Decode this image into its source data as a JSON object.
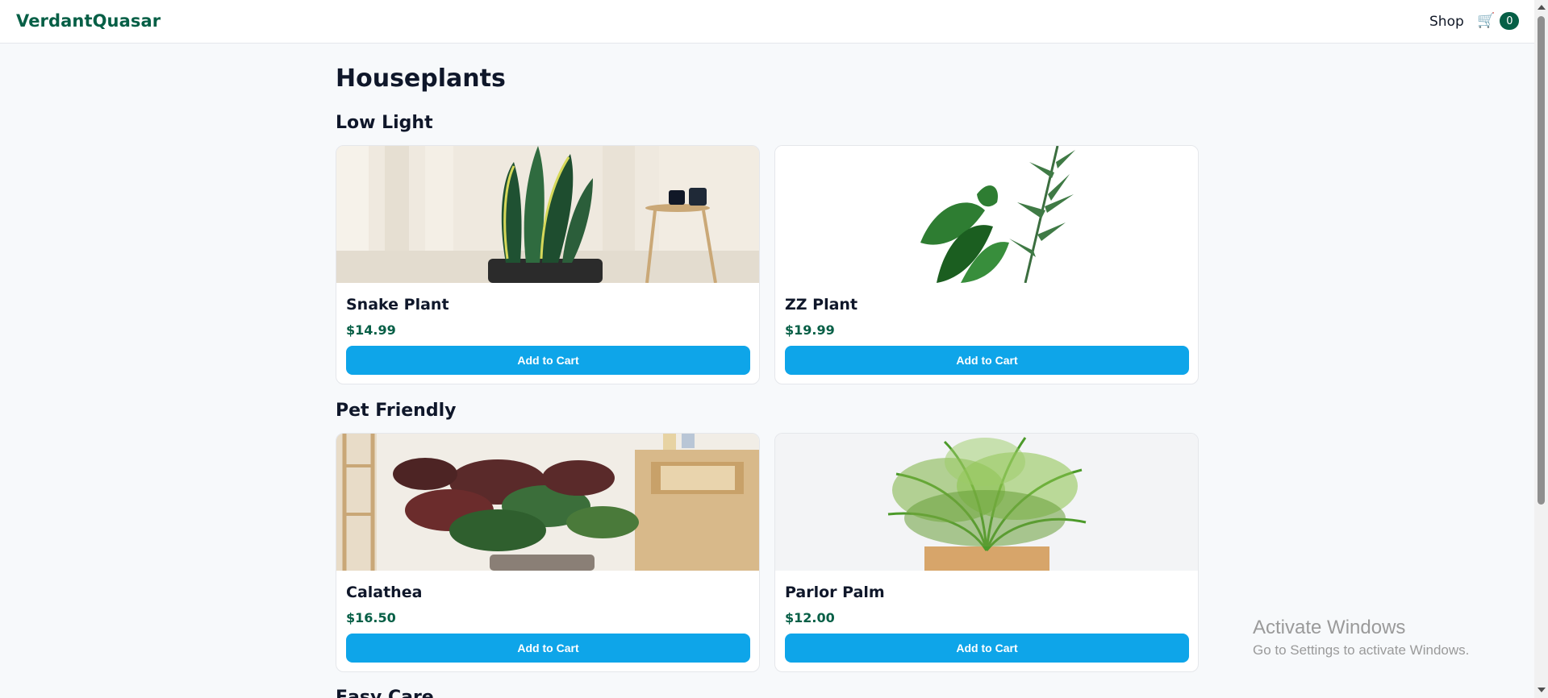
{
  "header": {
    "logo": "VerdantQuasar",
    "nav_shop": "Shop",
    "cart_icon": "cart-icon",
    "cart_count": "0"
  },
  "page": {
    "title": "Houseplants"
  },
  "sections": [
    {
      "title": "Low Light",
      "products": [
        {
          "name": "Snake Plant",
          "price": "$14.99",
          "button": "Add to Cart"
        },
        {
          "name": "ZZ Plant",
          "price": "$19.99",
          "button": "Add to Cart"
        }
      ]
    },
    {
      "title": "Pet Friendly",
      "products": [
        {
          "name": "Calathea",
          "price": "$16.50",
          "button": "Add to Cart"
        },
        {
          "name": "Parlor Palm",
          "price": "$12.00",
          "button": "Add to Cart"
        }
      ]
    },
    {
      "title": "Easy Care"
    }
  ],
  "watermark": {
    "title": "Activate Windows",
    "subtitle": "Go to Settings to activate Windows."
  },
  "colors": {
    "brand": "#065f46",
    "button": "#0ea5e9",
    "background": "#f7f9fb"
  }
}
